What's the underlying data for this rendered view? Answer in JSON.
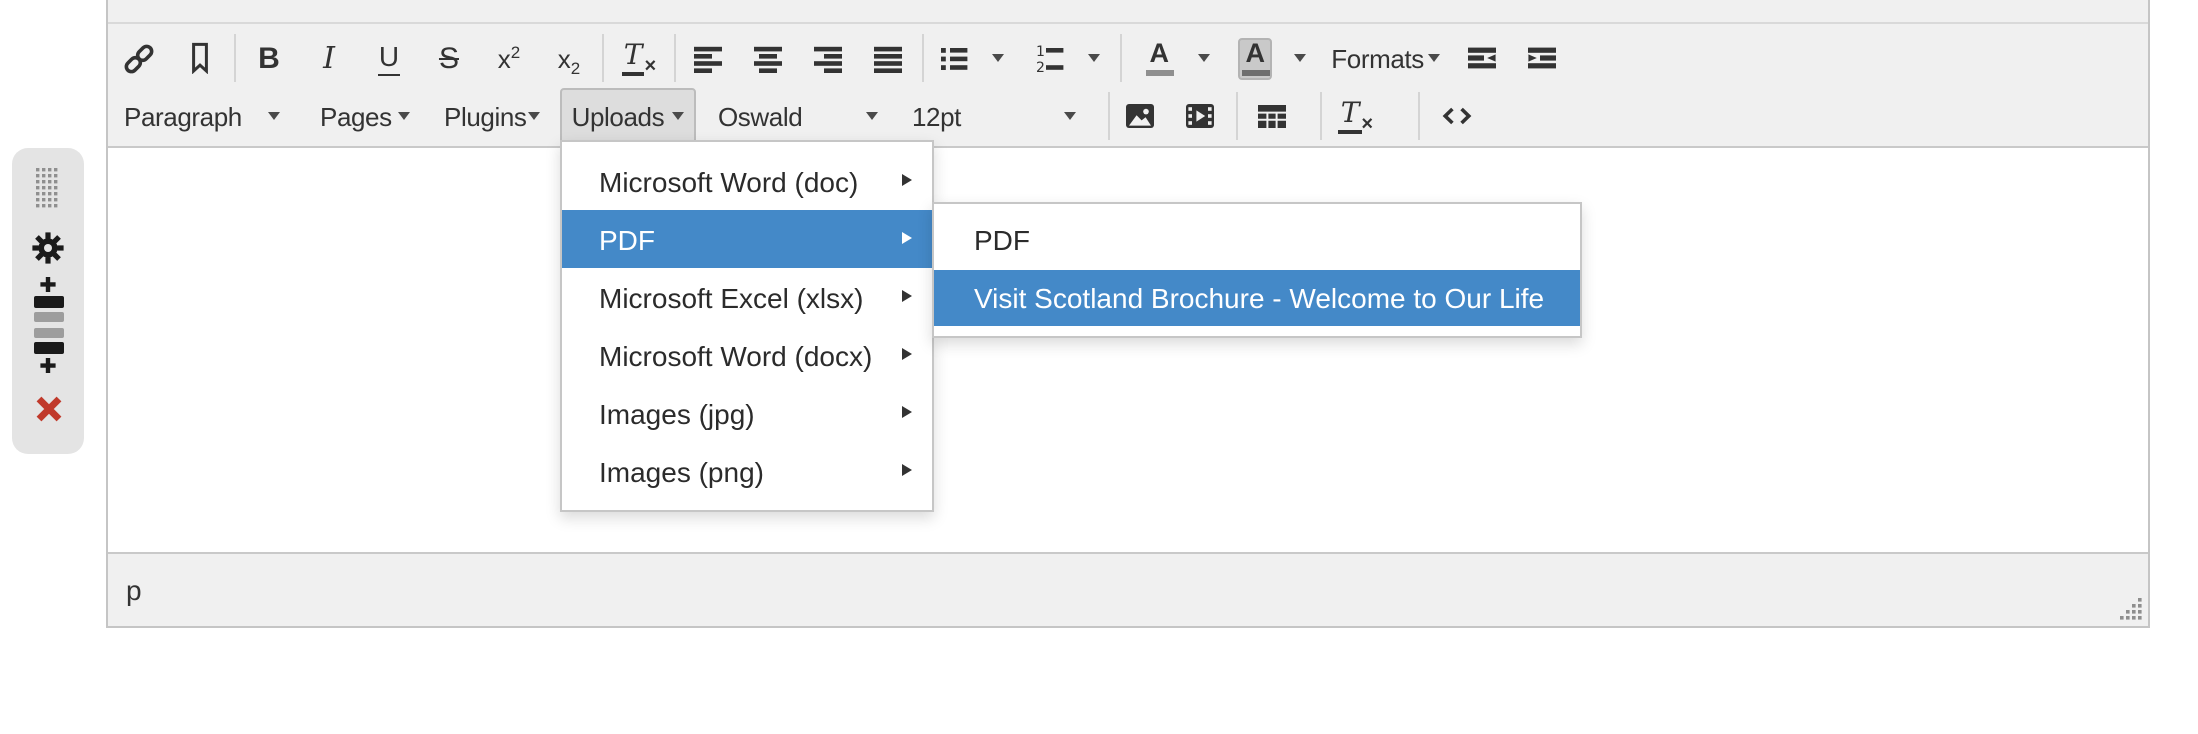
{
  "toolbar": {
    "formats_label": "Formats",
    "paragraph_label": "Paragraph",
    "pages_label": "Pages",
    "plugins_label": "Plugins",
    "uploads_label": "Uploads",
    "font_family_label": "Oswald",
    "font_size_label": "12pt",
    "bold_glyph": "B",
    "italic_glyph": "I",
    "underline_glyph": "U",
    "strikethrough_glyph": "S",
    "x_glyph": "x",
    "sup_glyph": "2",
    "sub_glyph": "2",
    "clear_T_glyph": "T",
    "clear_x_glyph": "×",
    "color_A_glyph": "A"
  },
  "menus": {
    "uploads": {
      "items": [
        {
          "label": "Microsoft Word (doc)"
        },
        {
          "label": "PDF",
          "active": true
        },
        {
          "label": "Microsoft Excel (xlsx)"
        },
        {
          "label": "Microsoft Word (docx)"
        },
        {
          "label": "Images (jpg)"
        },
        {
          "label": "Images (png)"
        }
      ]
    },
    "pdf_submenu": {
      "items": [
        {
          "label": "PDF"
        },
        {
          "label": "Visit Scotland Brochure - Welcome to Our Life",
          "active": true
        }
      ]
    }
  },
  "statusbar": {
    "element_path": "p"
  },
  "colors": {
    "menu_highlight": "#4489c8",
    "toolbar_bg": "#f0f0f0",
    "delete_red": "#c0392b"
  }
}
